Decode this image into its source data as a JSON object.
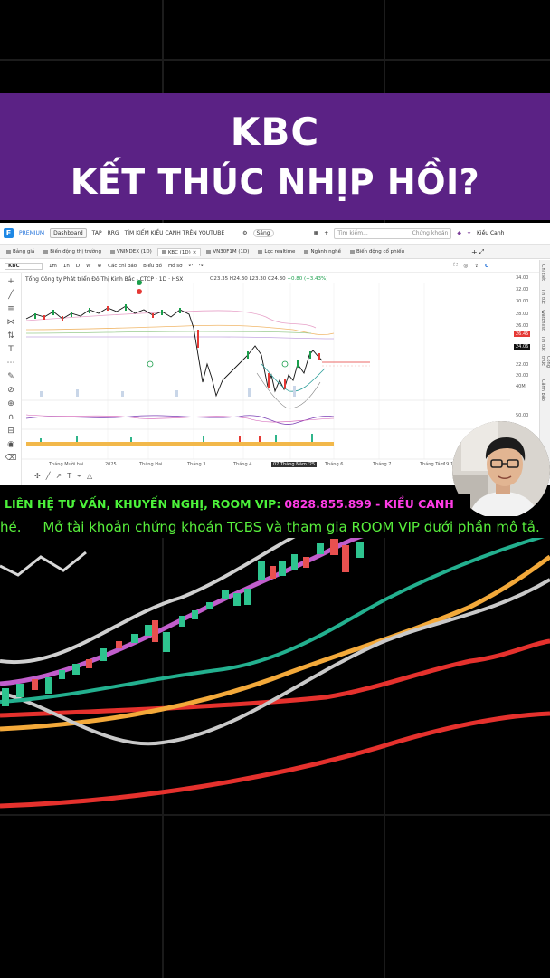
{
  "banner": {
    "line1": "KBC",
    "line2": "KẾT THÚC NHỊP HỒI?",
    "color": "#5b2285"
  },
  "app": {
    "premium_label": "PREMIUM",
    "topbar": {
      "dashboard": "Dashboard",
      "links": [
        "TAP",
        "RRG",
        "TÌM KIẾM KIỀU CANH TRÊN YOUTUBE"
      ],
      "toggle_label": "Sáng",
      "search_placeholder": "Tìm kiếm...",
      "search_scope": "Chứng khoán",
      "user_name": "Kiều Canh"
    },
    "tabs": [
      {
        "label": "Bảng giá"
      },
      {
        "label": "Biến động thị trường"
      },
      {
        "label": "VNINDEX (1D)"
      },
      {
        "label": "KBC (1D)"
      },
      {
        "label": "VN30F1M (1D)"
      },
      {
        "label": "Lọc realtime"
      },
      {
        "label": "Ngành nghề"
      },
      {
        "label": "Biến động cổ phiếu"
      }
    ],
    "toolbar": {
      "symbol": "KBC",
      "intervals": [
        "1m",
        "1h",
        "D",
        "W"
      ],
      "indicators": "Các chỉ báo",
      "chart_type": "Biểu đồ",
      "profile": "Hồ sơ"
    },
    "chart": {
      "title": "Tổng Công ty Phát triển Đô Thị Kinh Bắc - CTCP · 1D · HSX",
      "ohlc": "O23.35 H24.30 L23.30 C24.30",
      "change": "+0.80 (+3.43%)",
      "price_axis": [
        "34.00",
        "32.00",
        "30.00",
        "28.00",
        "26.00",
        "22.00",
        "20.00",
        "18.00"
      ],
      "price_tags": [
        {
          "label": "26.45",
          "color": "#e53935"
        },
        {
          "label": "24.06",
          "color": "#111111"
        }
      ],
      "volume_label": "40M",
      "osc_label": "50.00",
      "time_labels": [
        "Tháng Mười hai",
        "2025",
        "Tháng Hai",
        "Tháng 3",
        "Tháng 4",
        "07 Tháng Năm '25",
        "Tháng 6",
        "Tháng 7",
        "Tháng Tám"
      ],
      "time_right": "19:1"
    },
    "right_rail": [
      "Chi tiết",
      "Tin tức",
      "Watchlist",
      "Tin tức",
      "Công thức",
      "Cảnh báo"
    ]
  },
  "contact": {
    "prefix": "LIÊN HỆ TƯ VẤN, KHUYẾN NGHỊ, ROOM VIP:",
    "phone": "0828.855.899 - KIỀU CANH"
  },
  "ticker": {
    "text": "hé.     Mở tài khoản chứng khoán TCBS và tham gia ROOM VIP dưới phần mô tả."
  }
}
